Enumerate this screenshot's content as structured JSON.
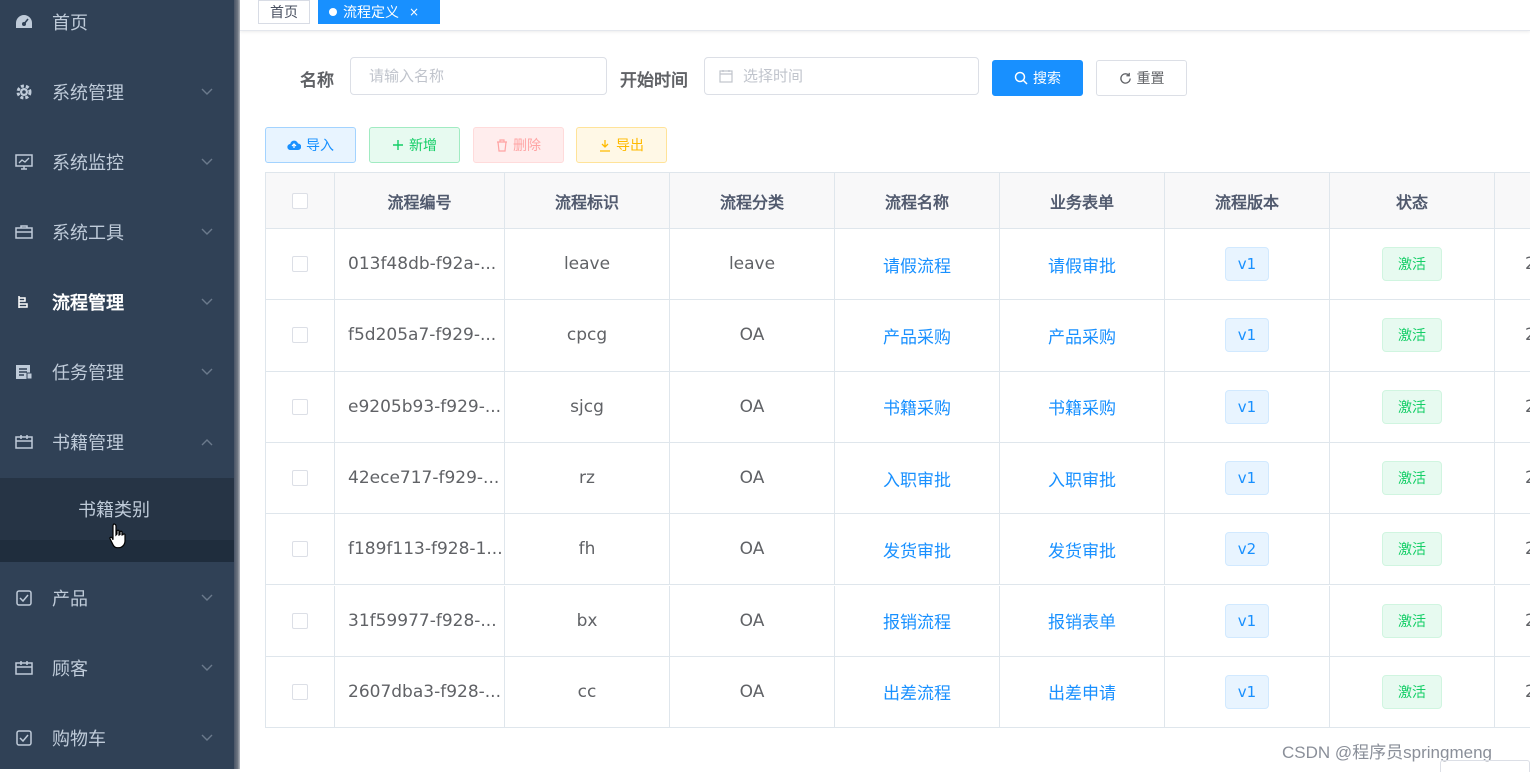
{
  "sidebar": {
    "items": [
      {
        "label": "首页",
        "icon": "dashboard-icon",
        "has_arrow": false
      },
      {
        "label": "系统管理",
        "icon": "gear-icon",
        "has_arrow": true
      },
      {
        "label": "系统监控",
        "icon": "monitor-icon",
        "has_arrow": true
      },
      {
        "label": "系统工具",
        "icon": "toolbox-icon",
        "has_arrow": true
      },
      {
        "label": "流程管理",
        "icon": "flow-icon",
        "has_arrow": true
      },
      {
        "label": "任务管理",
        "icon": "task-icon",
        "has_arrow": true
      },
      {
        "label": "书籍管理",
        "icon": "book-icon",
        "has_arrow": true,
        "expanded": true
      },
      {
        "label": "产品",
        "icon": "checkbox-icon",
        "has_arrow": true
      },
      {
        "label": "顾客",
        "icon": "calendar-icon",
        "has_arrow": true
      },
      {
        "label": "购物车",
        "icon": "checkbox-icon",
        "has_arrow": true
      }
    ],
    "submenu_label": "书籍类别"
  },
  "tags": {
    "home": "首页",
    "active": "流程定义",
    "close": "×"
  },
  "search": {
    "name_label": "名称",
    "name_placeholder": "请输入名称",
    "time_label": "开始时间",
    "time_placeholder": "选择时间",
    "search_button": "搜索",
    "reset_button": "重置"
  },
  "toolbar": {
    "import": "导入",
    "add": "新增",
    "delete": "删除",
    "export": "导出"
  },
  "table": {
    "columns": [
      "流程编号",
      "流程标识",
      "流程分类",
      "流程名称",
      "业务表单",
      "流程版本",
      "状态"
    ],
    "rows": [
      {
        "id": "013f48db-f92a-...",
        "key": "leave",
        "category": "leave",
        "name": "请假流程",
        "form": "请假审批",
        "version": "v1",
        "status": "激活"
      },
      {
        "id": "f5d205a7-f929-...",
        "key": "cpcg",
        "category": "OA",
        "name": "产品采购",
        "form": "产品采购",
        "version": "v1",
        "status": "激活"
      },
      {
        "id": "e9205b93-f929-...",
        "key": "sjcg",
        "category": "OA",
        "name": "书籍采购",
        "form": "书籍采购",
        "version": "v1",
        "status": "激活"
      },
      {
        "id": "42ece717-f929-...",
        "key": "rz",
        "category": "OA",
        "name": "入职审批",
        "form": "入职审批",
        "version": "v1",
        "status": "激活"
      },
      {
        "id": "f189f113-f928-1...",
        "key": "fh",
        "category": "OA",
        "name": "发货审批",
        "form": "发货审批",
        "version": "v2",
        "status": "激活"
      },
      {
        "id": "31f59977-f928-...",
        "key": "bx",
        "category": "OA",
        "name": "报销流程",
        "form": "报销表单",
        "version": "v1",
        "status": "激活"
      },
      {
        "id": "2607dba3-f928-...",
        "key": "cc",
        "category": "OA",
        "name": "出差流程",
        "form": "出差申请",
        "version": "v1",
        "status": "激活"
      }
    ],
    "overflow_text": "2"
  },
  "watermark": "CSDN @程序员springmeng",
  "colors": {
    "sidebar_bg": "#304156",
    "primary": "#1890ff",
    "success": "#13ce66",
    "danger": "#ff4949",
    "warning": "#ffba00"
  }
}
